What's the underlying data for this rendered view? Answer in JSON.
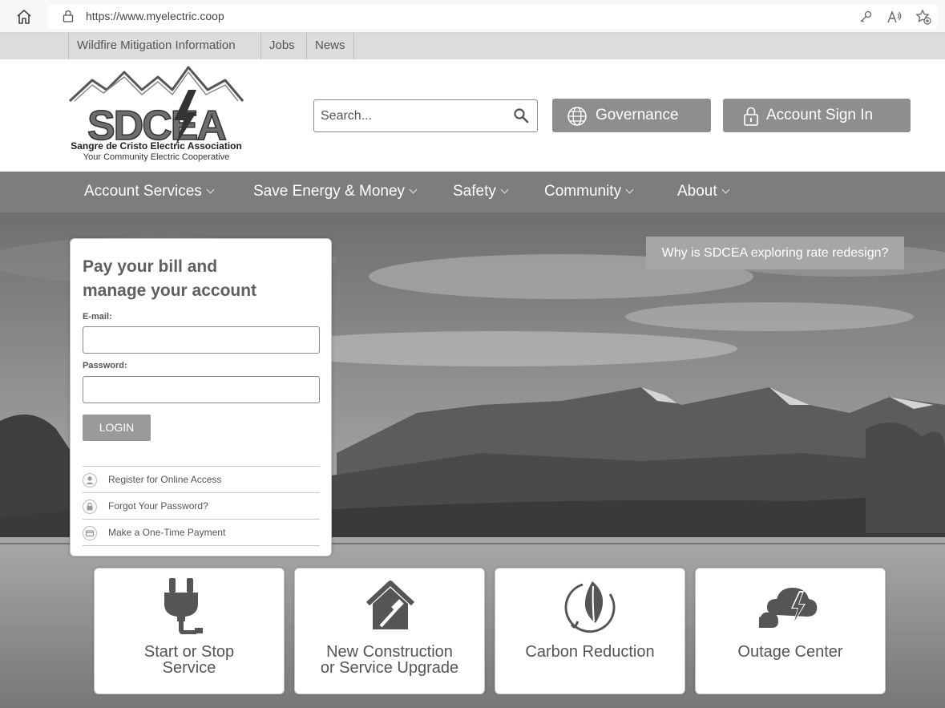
{
  "browser": {
    "url": "https://www.myelectric.coop"
  },
  "top_links": [
    "Wildfire Mitigation Information",
    "Jobs",
    "News"
  ],
  "header": {
    "logo_text": "SDCEA",
    "org_name": "Sangre de Cristo Electric Association",
    "tagline": "Your Community Electric Cooperative",
    "search_placeholder": "Search...",
    "governance_label": "Governance",
    "account_signin_label": "Account Sign In"
  },
  "nav": {
    "items": [
      {
        "label": "Account Services"
      },
      {
        "label": "Save Energy & Money"
      },
      {
        "label": "Safety"
      },
      {
        "label": "Community"
      },
      {
        "label": "About"
      }
    ]
  },
  "hero": {
    "rate_button": "Why is SDCEA exploring rate redesign?"
  },
  "login": {
    "title_line1": "Pay your bill and",
    "title_line2": "manage your account",
    "email_label": "E-mail:",
    "password_label": "Password:",
    "login_button": "LOGIN",
    "links": [
      {
        "label": "Register for Online Access",
        "icon": "user-icon"
      },
      {
        "label": "Forgot Your Password?",
        "icon": "lock-icon"
      },
      {
        "label": "Make a One-Time Payment",
        "icon": "card-icon"
      }
    ]
  },
  "tiles": [
    {
      "line1": "Start or Stop",
      "line2": "Service",
      "icon": "plug-icon"
    },
    {
      "line1": "New Construction",
      "line2": "or Service Upgrade",
      "icon": "house-hammer-icon"
    },
    {
      "line1": "Carbon Reduction",
      "line2": "",
      "icon": "leaf-icon"
    },
    {
      "line1": "Outage Center",
      "line2": "",
      "icon": "storm-cloud-icon"
    }
  ],
  "colors": {
    "nav_bg": "#7d7d7d",
    "button_bg": "#8e8e8e",
    "top_links_bg": "#dcdcdc"
  }
}
